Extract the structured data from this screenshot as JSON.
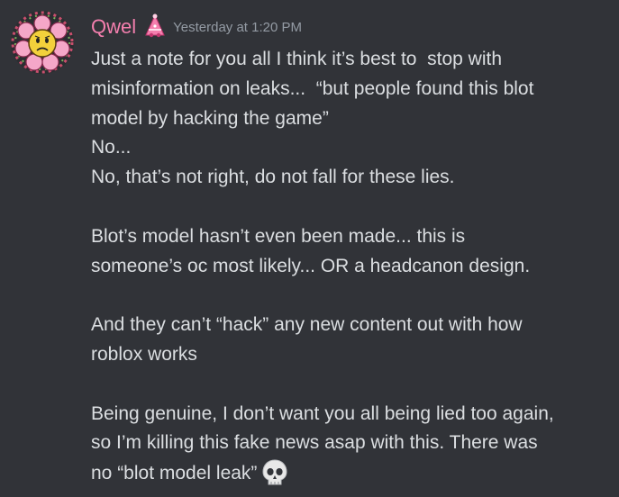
{
  "message": {
    "author": "Qwel",
    "timestamp": "Yesterday at 1:20 PM",
    "role_icon": "party-hat-icon",
    "avatar_icon": "flower-face-icon",
    "colors": {
      "background": "#313338",
      "username": "#f47fae",
      "text": "#dbdee1",
      "timestamp": "#949ba4"
    },
    "lines": [
      "Just a note for you all I think it’s best to  stop with",
      "misinformation on leaks...  “but people found this blot",
      "model by hacking the game”",
      "No...",
      "No, that’s not right, do not fall for these lies.",
      "",
      "Blot’s model hasn’t even been made... this is",
      "someone’s oc most likely... OR a headcanon design.",
      "",
      "And they can’t “hack” any new content out with how",
      "roblox works",
      "",
      "Being genuine, I don’t want you all being lied too again,",
      "so I’m killing this fake news asap with this. There was",
      "no “blot model leak”"
    ],
    "trailing_emoji": "skull-emoji"
  }
}
